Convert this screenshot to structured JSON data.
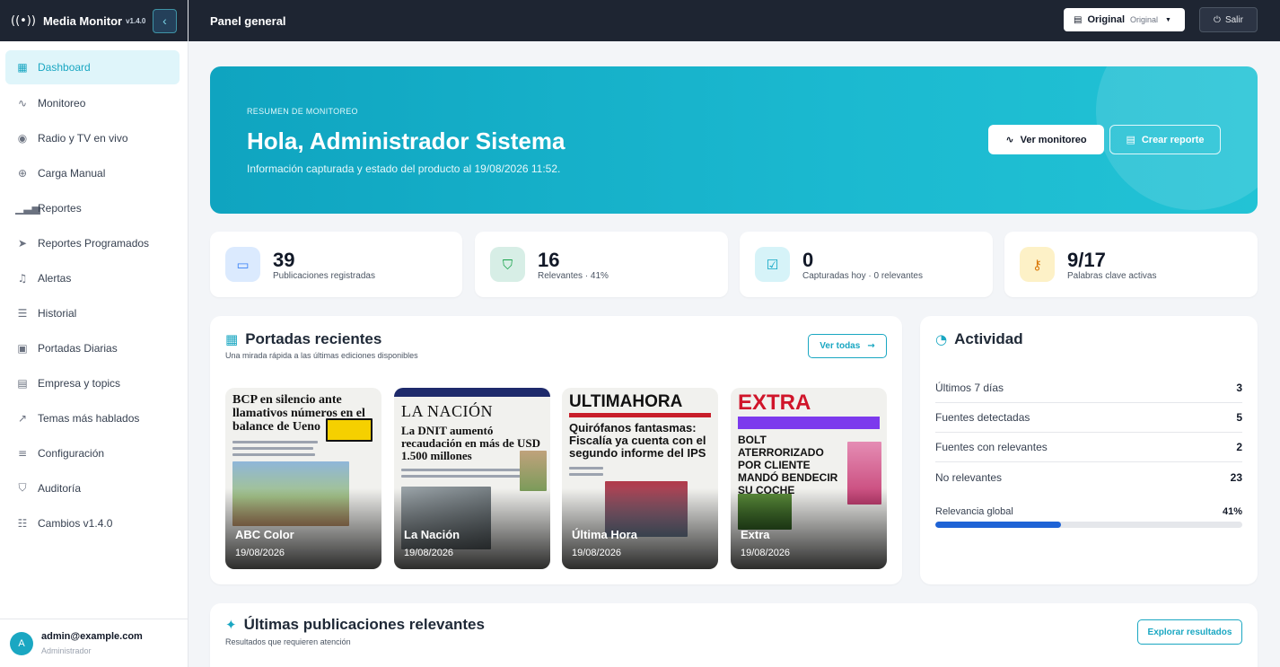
{
  "app": {
    "name": "Media Monitor",
    "version": "v1.4.0"
  },
  "sidebar": {
    "items": [
      {
        "label": "Dashboard",
        "icon": "dashboard-icon"
      },
      {
        "label": "Monitoreo",
        "icon": "activity-icon"
      },
      {
        "label": "Radio y TV en vivo",
        "icon": "broadcast-icon"
      },
      {
        "label": "Carga Manual",
        "icon": "plus-circle-icon"
      },
      {
        "label": "Reportes",
        "icon": "bar-chart-icon"
      },
      {
        "label": "Reportes Programados",
        "icon": "send-icon"
      },
      {
        "label": "Alertas",
        "icon": "bell-icon"
      },
      {
        "label": "Historial",
        "icon": "archive-icon"
      },
      {
        "label": "Portadas Diarias",
        "icon": "image-icon"
      },
      {
        "label": "Empresa y topics",
        "icon": "building-icon"
      },
      {
        "label": "Temas más hablados",
        "icon": "trend-icon"
      },
      {
        "label": "Configuración",
        "icon": "sliders-icon"
      },
      {
        "label": "Auditoría",
        "icon": "shield-icon"
      },
      {
        "label": "Cambios v1.4.0",
        "icon": "changelog-icon"
      }
    ],
    "active": "Dashboard"
  },
  "user": {
    "initial": "A",
    "email": "admin@example.com",
    "role": "Administrador"
  },
  "topbar": {
    "title": "Panel general",
    "mode_selected": "Original",
    "mode_sub": "Original",
    "logout": "Salir"
  },
  "hero": {
    "eyebrow": "RESUMEN DE MONITOREO",
    "title": "Hola, Administrador Sistema",
    "subtitle": "Información capturada y estado del producto al 19/08/2026 11:52.",
    "btn_monitor": "Ver monitoreo",
    "btn_report": "Crear reporte"
  },
  "stats": [
    {
      "value": "39",
      "label": "Publicaciones registradas",
      "color": "#dbeafe",
      "icon_color": "#3b82f6"
    },
    {
      "value": "16",
      "label": "Relevantes · 41%",
      "color": "#d7eee6",
      "icon_color": "#16a34a"
    },
    {
      "value": "0",
      "label": "Capturadas hoy · 0 relevantes",
      "color": "#d6f3f8",
      "icon_color": "#0ea5c4"
    },
    {
      "value": "9/17",
      "label": "Palabras clave activas",
      "color": "#fdf1c7",
      "icon_color": "#d97706"
    }
  ],
  "portadas": {
    "title": "Portadas recientes",
    "subtitle": "Una mirada rápida a las últimas ediciones disponibles",
    "see_all": "Ver todas",
    "items": [
      {
        "name": "ABC Color",
        "date": "19/08/2026",
        "headline": "BCP en silencio ante llamativos números en el balance de Ueno"
      },
      {
        "name": "La Nación",
        "date": "19/08/2026",
        "masthead": "LA NACIÓN",
        "headline": "La DNIT aumentó recaudación en más de USD 1.500 millones"
      },
      {
        "name": "Última Hora",
        "date": "19/08/2026",
        "masthead": "ULTIMAHORA",
        "headline": "Quirófanos fantasmas: Fiscalía ya cuenta con el segundo informe del IPS"
      },
      {
        "name": "Extra",
        "date": "19/08/2026",
        "masthead": "EXTRA",
        "headline": "BOLT ATERRORIZADO POR CLIENTE MANDÓ BENDECIR SU COCHE"
      }
    ]
  },
  "actividad": {
    "title": "Actividad",
    "rows": [
      {
        "label": "Últimos 7 días",
        "value": "3"
      },
      {
        "label": "Fuentes detectadas",
        "value": "5"
      },
      {
        "label": "Fuentes con relevantes",
        "value": "2"
      },
      {
        "label": "No relevantes",
        "value": "23"
      }
    ],
    "relevance_label": "Relevancia global",
    "relevance_value": "41%",
    "relevance_fraction": 0.41
  },
  "ultimas": {
    "title": "Últimas publicaciones relevantes",
    "subtitle": "Resultados que requieren atención",
    "explore": "Explorar resultados"
  }
}
